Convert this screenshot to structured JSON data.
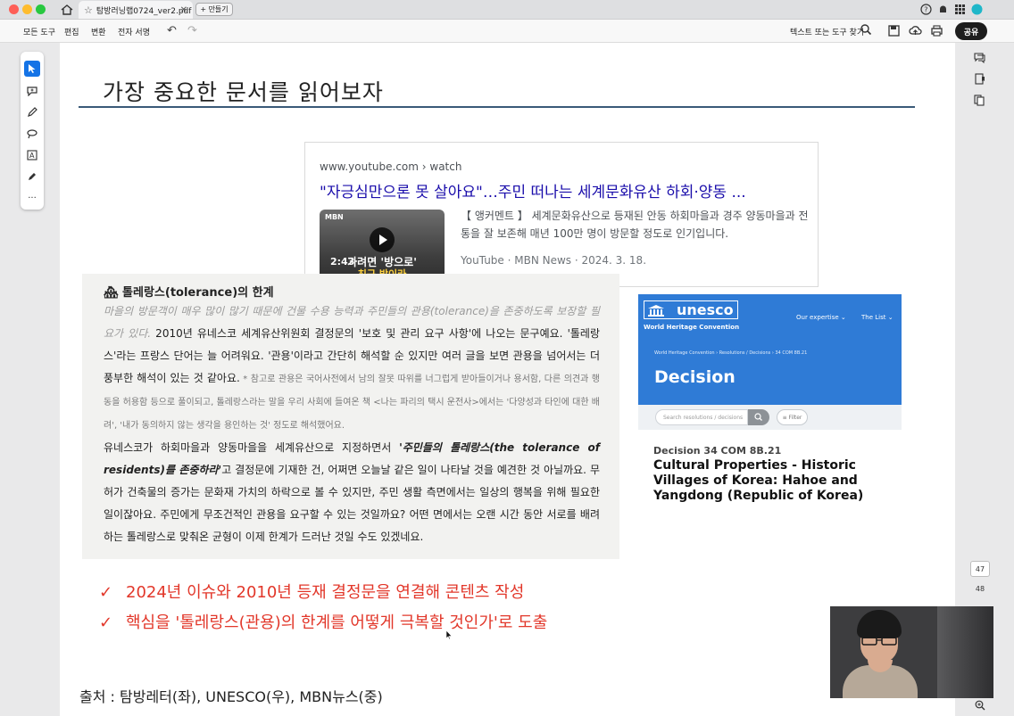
{
  "window": {
    "tab_title": "탐방러닝랩0724_ver2.pdf",
    "new_tab_label": "+ 만들기"
  },
  "toolbar": {
    "menus": [
      "모든 도구",
      "편집",
      "변환",
      "전자 서명"
    ],
    "find_label": "텍스트 또는 도구 찾기",
    "share_label": "공유"
  },
  "slide": {
    "title": "가장 중요한 문서를 읽어보자",
    "youtube": {
      "url": "www.youtube.com › watch",
      "title": "\"자긍심만으론 못 살아요\"…주민 떠나는 세계문화유산 하회·양동 ...",
      "thumb_logo": "MBN",
      "thumb_overlay": "가려면 '방으로'",
      "thumb_overlay2": "친구 방이라",
      "duration": "2:43",
      "description": "【 앵커멘트 】 세계문화유산으로 등재된 안동 하회마을과 경주 양동마을과 전통을 잘 보존해 매년 100만 명이 방문할 정도로 인기입니다.",
      "meta": "YouTube · MBN News · 2024. 3. 18."
    },
    "unesco": {
      "logo_text": "unesco",
      "subtitle": "World Heritage Convention",
      "nav_expertise": "Our expertise ⌄",
      "nav_list": "The List ⌄",
      "breadcrumb": "World Heritage Convention  ›  Resolutions / Decisions  ›  34 COM 8B.21",
      "heading": "Decision",
      "search_placeholder": "Search resolutions / decisions",
      "filter_label": "≡ Filter",
      "decision_id": "Decision 34 COM 8B.21",
      "decision_title": "Cultural Properties - Historic Villages of Korea: Hahoe and Yangdong (Republic of Korea)"
    },
    "excerpt": {
      "heading": "톨레랑스(tolerance)의 한계",
      "p1_gray": "마을의 방문객이 매우 많이 많기 때문에 건물 수용 능력과 주민들의 관용(tolerance)을 존중하도록 보장할 필요가 있다.",
      "p1_text": " 2010년 유네스코 세계유산위원회 결정문의 '보호 및 관리 요구 사항'에 나오는 문구예요. '톨레랑스'라는 프랑스 단어는 늘 어려워요. '관용'이라고 간단히 해석할 순 있지만 여러 글을 보면 관용을 넘어서는 더 풍부한 해석이 있는 것 같아요.",
      "p1_small": " * 참고로 관용은 국어사전에서 남의 잘못 따위를 너그럽게 받아들이거나 용서함, 다른 의견과 행동을 허용함 등으로 풀이되고, 톨레랑스라는 말을 우리 사회에 들여온 책 <나는 파리의 택시 운전사>에서는 '다양성과 타인에 대한 배려', '내가 동의하지 않는 생각을 용인하는 것' 정도로 해석했어요.",
      "p2_a": "유네스코가 하회마을과 양동마을을 세계유산으로 지정하면서 ",
      "p2_bi": "'주민들의 톨레랑스(the tolerance of residents)를 존중하라'",
      "p2_b": "고 결정문에 기재한 건, 어쩌면 오늘날 같은 일이 나타날 것을 예견한 것 아닐까요. 무허가 건축물의 증가는 문화재 가치의 하락으로 볼 수 있지만, 주민 생활 측면에서는 일상의 행복을 위해 필요한 일이잖아요. 주민에게 무조건적인 관용을 요구할 수 있는 것일까요? 어떤 면에서는 오랜 시간 동안 서로를 배려하는 톨레랑스로 맞춰온 균형이 이제 한계가 드러난 것일 수도 있겠네요."
    },
    "points": [
      "2024년 이슈와 2010년 등재 결정문을 연결해 콘텐츠 작성",
      "핵심을 '톨레랑스(관용)의 한계를 어떻게 극복할 것인가'로 도출"
    ],
    "check_mark": "✓",
    "source": "출처 : 탐방레터(좌), UNESCO(우), MBN뉴스(중)"
  },
  "pages": {
    "current": "47",
    "next": "48"
  },
  "colors": {
    "accent_red": "#e2372a",
    "link_blue": "#1a0dab",
    "unesco_blue": "#2f7bd6",
    "title_rule": "#3a5a78"
  }
}
